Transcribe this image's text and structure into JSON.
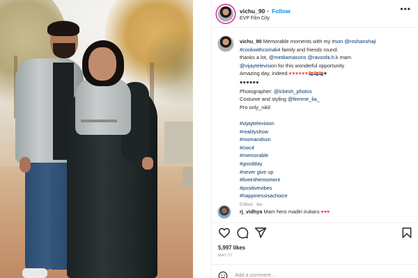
{
  "post": {
    "username": "vichu_90",
    "follow_label": "Follow",
    "location": "EVP Film City",
    "more_label": "•••"
  },
  "caption": {
    "line1_user": "vichu_90",
    "line1_text": " Memorable moments with my ",
    "line1_tag1": "#son",
    "line1_tag2": " @roshanshaji",
    "line2": "#cookwithcomali4",
    "line2_rest": " family and friends round.",
    "line3_pre": "thanks a lot, ",
    "line3_tag1": "@mediamasons",
    "line3_tag2": "@ravoofa.h.k",
    "line3_post": " mam",
    "line4_tag": "@vijaytelevision",
    "line4_post": " for this wonderful opportunity",
    "line5_text": "Amazing day, indeed.",
    "line5_hearts": "♥♥♥♥♥♥",
    "line5_flags": "🏳️‍🌈🏳️‍🌈🏳️‍🌈",
    "line5_bheart": "♥",
    "line6_hearts": "♥♥♥♥♥♥",
    "line7_pre": "Photographer: ",
    "line7_tag": "@lckesh_photos",
    "line8_pre": "Costume and styling ",
    "line8_tag": "@femme_lia_",
    "line9": "Pro only_nikil",
    "hashtags": [
      "#vijaytelevision",
      "#realityshow",
      "#momandson",
      "#cwc4",
      "#memorable",
      "#goodday",
      "#never give up",
      "#liveinthemoment",
      "#positivevibes",
      "#happinessisachoice"
    ],
    "edited": "Edited · 6w"
  },
  "comment": {
    "user": "rj_vidhya",
    "text": " Mam hero madiri irukaru ",
    "hearts": "♥♥♥"
  },
  "stats": {
    "likes": "5,997 likes",
    "date": "MAY 27"
  },
  "composer": {
    "placeholder": "Add a comment…"
  },
  "colors": {
    "follow_blue": "#0095f6",
    "tag_blue": "#00376b",
    "heart_red": "#ed4956"
  },
  "icons": [
    "heart-icon",
    "comment-icon",
    "share-icon",
    "bookmark-icon",
    "smile-icon",
    "more-icon"
  ]
}
